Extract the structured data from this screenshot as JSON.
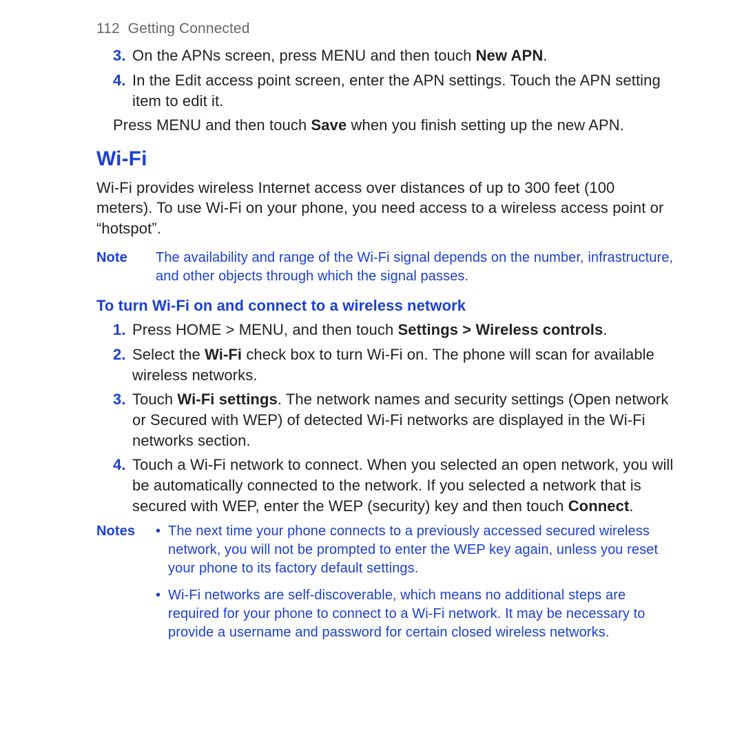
{
  "header": {
    "page_number": "112",
    "title": "Getting Connected"
  },
  "apn": {
    "step3_num": "3.",
    "step3_pre": "On the APNs screen, press MENU and then touch ",
    "step3_bold": "New APN",
    "step3_post": ".",
    "step4_num": "4.",
    "step4_text": "In the Edit access point screen, enter the APN settings. Touch the APN setting item to edit it.",
    "save_pre": "Press MENU and then touch ",
    "save_bold": "Save",
    "save_post": " when you finish setting up the new APN."
  },
  "wifi": {
    "heading": "Wi-Fi",
    "intro": "Wi-Fi provides wireless Internet access over distances of up to 300 feet (100 meters). To use Wi-Fi on your phone, you need access to a wireless access point or “hotspot”.",
    "note_label": "Note",
    "note_text": "The availability and range of the Wi-Fi signal depends on the number, infrastructure, and other objects through which the signal passes.",
    "subheading": "To turn Wi-Fi on and connect to a wireless network",
    "steps": {
      "s1_num": "1.",
      "s1_pre": "Press HOME > MENU, and then touch ",
      "s1_bold": "Settings > Wireless controls",
      "s1_post": ".",
      "s2_num": "2.",
      "s2_pre": "Select the ",
      "s2_bold": "Wi-Fi",
      "s2_post": " check box to turn Wi-Fi on. The phone will scan for available wireless networks.",
      "s3_num": "3.",
      "s3_pre": "Touch ",
      "s3_bold": "Wi-Fi settings",
      "s3_post": ". The network names and security settings (Open network or Secured with WEP) of detected Wi-Fi networks are displayed in the Wi-Fi networks section.",
      "s4_num": "4.",
      "s4_pre": "Touch a Wi-Fi network to connect. When you selected an open network, you will be automatically connected to the network. If you selected a network that is secured with WEP, enter the WEP (security) key and then touch ",
      "s4_bold": "Connect",
      "s4_post": "."
    },
    "notes_label": "Notes",
    "notes": {
      "bullet": "•",
      "n1": "The next time your phone connects to a previously accessed secured wireless network, you will not be prompted to enter the WEP key again, unless you reset your phone to its factory default settings.",
      "n2": "Wi-Fi networks are self-discoverable, which means no additional steps are required for your phone to connect to a Wi-Fi network. It may be necessary to provide a username and password for certain closed wireless networks."
    }
  }
}
